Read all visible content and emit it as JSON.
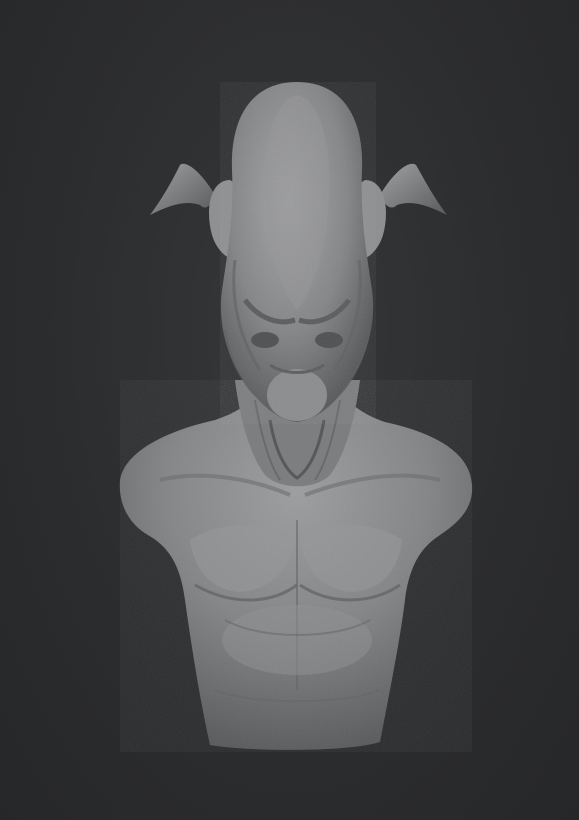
{
  "viewport": {
    "background": "#2b2c2e",
    "subject": "sculpt-bust"
  },
  "sculpt": {
    "material_color": "#8a8b8d",
    "highlight_color": "#b3b4b6",
    "shadow_color": "#4a4b4d"
  }
}
